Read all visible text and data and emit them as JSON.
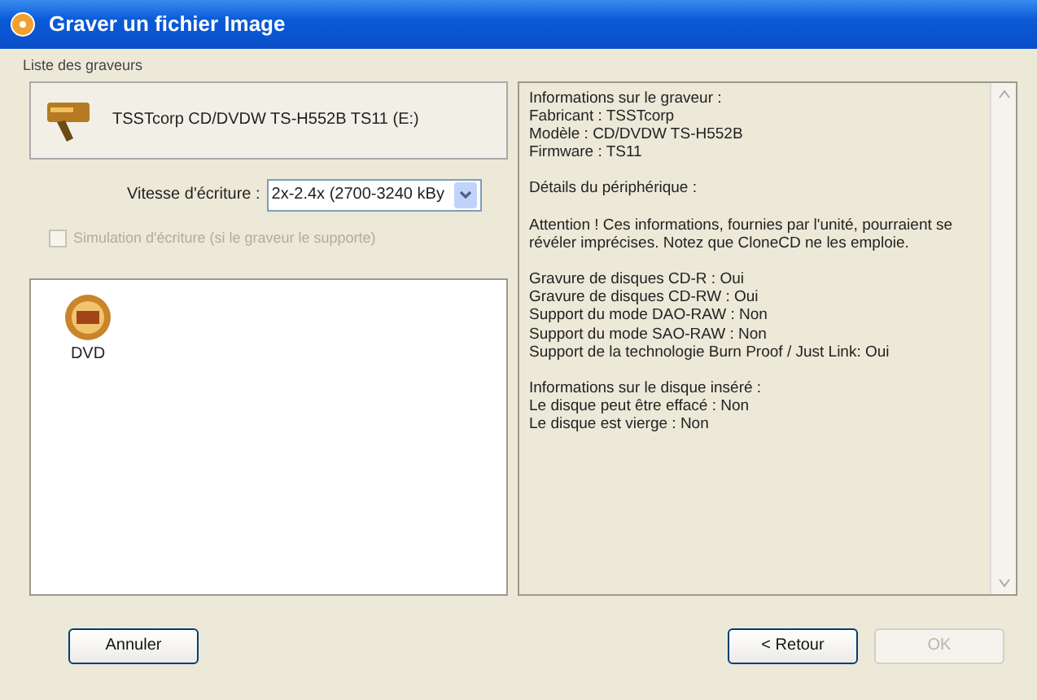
{
  "window": {
    "title": "Graver un fichier Image"
  },
  "group_label": "Liste des graveurs",
  "device": {
    "name": "TSSTcorp CD/DVDW TS-H552B TS11 (E:)"
  },
  "speed": {
    "label": "Vitesse d'écriture :",
    "value": "2x-2.4x (2700-3240 kBy"
  },
  "simulation": {
    "label": "Simulation d'écriture (si le graveur le supporte)",
    "checked": false,
    "disabled": true
  },
  "media": [
    {
      "label": "DVD",
      "selected": false
    }
  ],
  "info": [
    [
      "Informations sur le graveur :",
      "Fabricant : TSSTcorp",
      "Modèle : CD/DVDW TS-H552B",
      "Firmware : TS11"
    ],
    [
      "Détails du périphérique :"
    ],
    [
      "Attention ! Ces informations, fournies par l'unité, pourraient se révéler imprécises. Notez que CloneCD ne les emploie."
    ],
    [
      "Gravure de disques CD-R : Oui",
      "Gravure de disques CD-RW : Oui",
      "Support du mode DAO-RAW : Non",
      "Support du mode SAO-RAW : Non",
      "Support de la technologie Burn Proof / Just Link: Oui"
    ],
    [
      "Informations sur le disque inséré :",
      "Le disque peut être effacé : Non",
      "Le disque est vierge : Non"
    ]
  ],
  "buttons": [
    {
      "label": "Annuler",
      "disabled": false
    },
    {
      "label": "< Retour",
      "disabled": false
    },
    {
      "label": "OK",
      "disabled": true
    }
  ]
}
